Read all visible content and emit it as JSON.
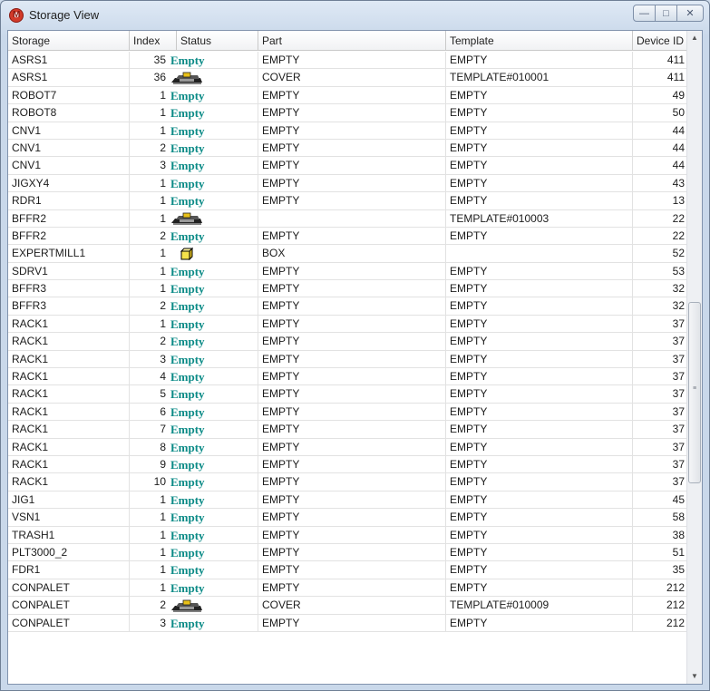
{
  "window": {
    "title": "Storage View",
    "minimize": "—",
    "maximize": "□",
    "close": "✕"
  },
  "columns": [
    "Storage",
    "Index",
    "Status",
    "Part",
    "Template",
    "Device ID"
  ],
  "rows": [
    {
      "storage": "ASRS1",
      "index": "35",
      "status": "Empty",
      "part": "EMPTY",
      "template": "EMPTY",
      "device_id": "411"
    },
    {
      "storage": "ASRS1",
      "index": "36",
      "status": "cover-icon",
      "part": "COVER",
      "template": "TEMPLATE#010001",
      "device_id": "411"
    },
    {
      "storage": "ROBOT7",
      "index": "1",
      "status": "Empty",
      "part": "EMPTY",
      "template": "EMPTY",
      "device_id": "49"
    },
    {
      "storage": "ROBOT8",
      "index": "1",
      "status": "Empty",
      "part": "EMPTY",
      "template": "EMPTY",
      "device_id": "50"
    },
    {
      "storage": "CNV1",
      "index": "1",
      "status": "Empty",
      "part": "EMPTY",
      "template": "EMPTY",
      "device_id": "44"
    },
    {
      "storage": "CNV1",
      "index": "2",
      "status": "Empty",
      "part": "EMPTY",
      "template": "EMPTY",
      "device_id": "44"
    },
    {
      "storage": "CNV1",
      "index": "3",
      "status": "Empty",
      "part": "EMPTY",
      "template": "EMPTY",
      "device_id": "44"
    },
    {
      "storage": "JIGXY4",
      "index": "1",
      "status": "Empty",
      "part": "EMPTY",
      "template": "EMPTY",
      "device_id": "43"
    },
    {
      "storage": "RDR1",
      "index": "1",
      "status": "Empty",
      "part": "EMPTY",
      "template": "EMPTY",
      "device_id": "13"
    },
    {
      "storage": "BFFR2",
      "index": "1",
      "status": "cover-icon",
      "part": "",
      "template": "TEMPLATE#010003",
      "device_id": "22"
    },
    {
      "storage": "BFFR2",
      "index": "2",
      "status": "Empty",
      "part": "EMPTY",
      "template": "EMPTY",
      "device_id": "22"
    },
    {
      "storage": "EXPERTMILL1",
      "index": "1",
      "status": "box-icon",
      "part": "BOX",
      "template": "",
      "device_id": "52"
    },
    {
      "storage": "SDRV1",
      "index": "1",
      "status": "Empty",
      "part": "EMPTY",
      "template": "EMPTY",
      "device_id": "53"
    },
    {
      "storage": "BFFR3",
      "index": "1",
      "status": "Empty",
      "part": "EMPTY",
      "template": "EMPTY",
      "device_id": "32"
    },
    {
      "storage": "BFFR3",
      "index": "2",
      "status": "Empty",
      "part": "EMPTY",
      "template": "EMPTY",
      "device_id": "32"
    },
    {
      "storage": "RACK1",
      "index": "1",
      "status": "Empty",
      "part": "EMPTY",
      "template": "EMPTY",
      "device_id": "37"
    },
    {
      "storage": "RACK1",
      "index": "2",
      "status": "Empty",
      "part": "EMPTY",
      "template": "EMPTY",
      "device_id": "37"
    },
    {
      "storage": "RACK1",
      "index": "3",
      "status": "Empty",
      "part": "EMPTY",
      "template": "EMPTY",
      "device_id": "37"
    },
    {
      "storage": "RACK1",
      "index": "4",
      "status": "Empty",
      "part": "EMPTY",
      "template": "EMPTY",
      "device_id": "37"
    },
    {
      "storage": "RACK1",
      "index": "5",
      "status": "Empty",
      "part": "EMPTY",
      "template": "EMPTY",
      "device_id": "37"
    },
    {
      "storage": "RACK1",
      "index": "6",
      "status": "Empty",
      "part": "EMPTY",
      "template": "EMPTY",
      "device_id": "37"
    },
    {
      "storage": "RACK1",
      "index": "7",
      "status": "Empty",
      "part": "EMPTY",
      "template": "EMPTY",
      "device_id": "37"
    },
    {
      "storage": "RACK1",
      "index": "8",
      "status": "Empty",
      "part": "EMPTY",
      "template": "EMPTY",
      "device_id": "37"
    },
    {
      "storage": "RACK1",
      "index": "9",
      "status": "Empty",
      "part": "EMPTY",
      "template": "EMPTY",
      "device_id": "37"
    },
    {
      "storage": "RACK1",
      "index": "10",
      "status": "Empty",
      "part": "EMPTY",
      "template": "EMPTY",
      "device_id": "37"
    },
    {
      "storage": "JIG1",
      "index": "1",
      "status": "Empty",
      "part": "EMPTY",
      "template": "EMPTY",
      "device_id": "45"
    },
    {
      "storage": "VSN1",
      "index": "1",
      "status": "Empty",
      "part": "EMPTY",
      "template": "EMPTY",
      "device_id": "58"
    },
    {
      "storage": "TRASH1",
      "index": "1",
      "status": "Empty",
      "part": "EMPTY",
      "template": "EMPTY",
      "device_id": "38"
    },
    {
      "storage": "PLT3000_2",
      "index": "1",
      "status": "Empty",
      "part": "EMPTY",
      "template": "EMPTY",
      "device_id": "51"
    },
    {
      "storage": "FDR1",
      "index": "1",
      "status": "Empty",
      "part": "EMPTY",
      "template": "EMPTY",
      "device_id": "35"
    },
    {
      "storage": "CONPALET",
      "index": "1",
      "status": "Empty",
      "part": "EMPTY",
      "template": "EMPTY",
      "device_id": "212"
    },
    {
      "storage": "CONPALET",
      "index": "2",
      "status": "cover-icon",
      "part": "COVER",
      "template": "TEMPLATE#010009",
      "device_id": "212"
    },
    {
      "storage": "CONPALET",
      "index": "3",
      "status": "Empty",
      "part": "EMPTY",
      "template": "EMPTY",
      "device_id": "212"
    }
  ],
  "colors": {
    "empty_status": "#0a8a86",
    "cover_icon": "#e8c018",
    "box_icon": "#f4e24a"
  }
}
